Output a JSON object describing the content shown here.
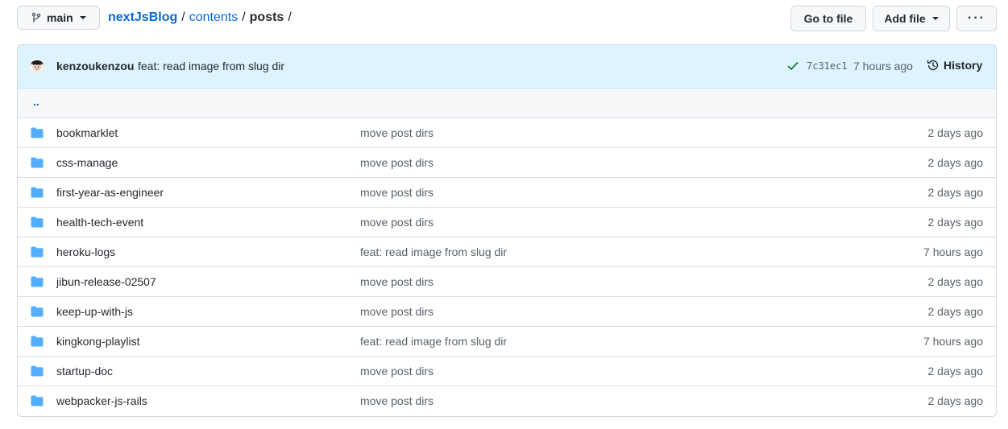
{
  "branch": {
    "name": "main"
  },
  "breadcrumb": {
    "root": "nextJsBlog",
    "sep": "/",
    "path1": "contents",
    "current": "posts"
  },
  "actions": {
    "go_to_file": "Go to file",
    "add_file": "Add file",
    "more": "···"
  },
  "commit": {
    "author": "kenzoukenzou",
    "message": "feat: read image from slug dir",
    "sha": "7c31ec1",
    "time": "7 hours ago",
    "history": "History",
    "status_color": "#1a7f37"
  },
  "parent": {
    "label": ".."
  },
  "folder_icon": "folder-icon",
  "accent_color": "#0969da",
  "files": [
    {
      "name": "bookmarklet",
      "message": "move post dirs",
      "age": "2 days ago"
    },
    {
      "name": "css-manage",
      "message": "move post dirs",
      "age": "2 days ago"
    },
    {
      "name": "first-year-as-engineer",
      "message": "move post dirs",
      "age": "2 days ago"
    },
    {
      "name": "health-tech-event",
      "message": "move post dirs",
      "age": "2 days ago"
    },
    {
      "name": "heroku-logs",
      "message": "feat: read image from slug dir",
      "age": "7 hours ago"
    },
    {
      "name": "jibun-release-02507",
      "message": "move post dirs",
      "age": "2 days ago"
    },
    {
      "name": "keep-up-with-js",
      "message": "move post dirs",
      "age": "2 days ago"
    },
    {
      "name": "kingkong-playlist",
      "message": "feat: read image from slug dir",
      "age": "7 hours ago"
    },
    {
      "name": "startup-doc",
      "message": "move post dirs",
      "age": "2 days ago"
    },
    {
      "name": "webpacker-js-rails",
      "message": "move post dirs",
      "age": "2 days ago"
    }
  ]
}
